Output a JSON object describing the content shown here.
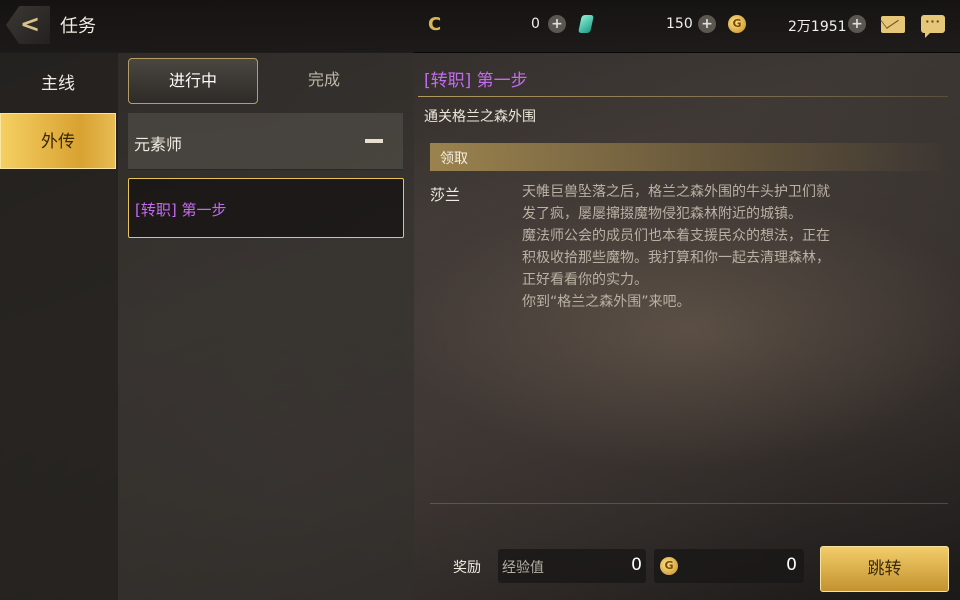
{
  "header": {
    "title": "任务",
    "resources": [
      {
        "icon": "moon-currency-icon",
        "value": ""
      },
      {
        "icon": "green-gem-icon",
        "value": "0"
      },
      {
        "icon": "gold-coin-icon",
        "value": "150"
      },
      {
        "icon": "gold-coin-icon",
        "value": "2万1951"
      }
    ]
  },
  "sidebar": {
    "items": [
      {
        "label": "主线",
        "active": false
      },
      {
        "label": "外传",
        "active": true
      }
    ]
  },
  "list": {
    "tabs": [
      {
        "label": "进行中",
        "active": true
      },
      {
        "label": "完成",
        "active": false
      }
    ],
    "group": {
      "label": "元素师"
    },
    "quests": [
      {
        "label": "[转职] 第一步",
        "selected": true
      }
    ]
  },
  "detail": {
    "title": "[转职] 第一步",
    "goal": "通关格兰之森外围",
    "status": "领取",
    "npc": "莎兰",
    "dialog": "天帷巨兽坠落之后，格兰之森外围的牛头护卫们就\n发了疯，屡屡撺掇魔物侵犯森林附近的城镇。\n魔法师公会的成员们也本着支援民众的想法，正在\n积极收拾那些魔物。我打算和你一起去清理森林，\n正好看看你的实力。\n你到“格兰之森外围”来吧。"
  },
  "reward": {
    "label": "奖励",
    "exp_label": "经验值",
    "exp_value": "0",
    "gold_value": "0"
  },
  "actions": {
    "jump_label": "跳转"
  },
  "colors": {
    "accent_gold": "#e8c35a",
    "quest_purple": "#c46af0"
  }
}
